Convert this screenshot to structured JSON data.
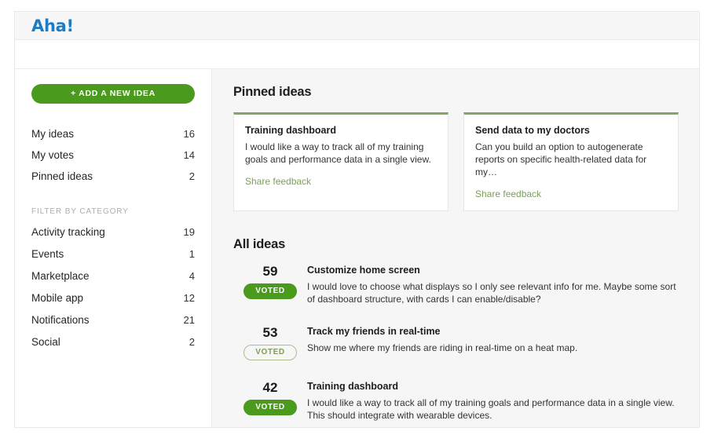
{
  "brand": {
    "logo_text": "Aha!",
    "logo_color": "#1d7cc4"
  },
  "sidebar": {
    "add_button_label": "+ ADD A NEW IDEA",
    "nav_items": [
      {
        "label": "My ideas",
        "count": "16"
      },
      {
        "label": "My votes",
        "count": "14"
      },
      {
        "label": "Pinned ideas",
        "count": "2"
      }
    ],
    "filter_heading": "FILTER BY CATEGORY",
    "categories": [
      {
        "label": "Activity tracking",
        "count": "19"
      },
      {
        "label": "Events",
        "count": "1"
      },
      {
        "label": "Marketplace",
        "count": "4"
      },
      {
        "label": "Mobile app",
        "count": "12"
      },
      {
        "label": "Notifications",
        "count": "21"
      },
      {
        "label": "Social",
        "count": "2"
      }
    ]
  },
  "main": {
    "pinned_title": "Pinned ideas",
    "pinned_cards": [
      {
        "title": "Training dashboard",
        "body": "I would like a way to track all of my training goals and performance data in a single view.",
        "link": "Share feedback"
      },
      {
        "title": "Send data to my doctors",
        "body": "Can you build an option to autogenerate reports on specific health-related data for my…",
        "link": "Share feedback"
      }
    ],
    "all_ideas_title": "All ideas",
    "ideas": [
      {
        "votes": "59",
        "badge": "VOTED",
        "badge_style": "filled",
        "title": "Customize home screen",
        "description": "I would love to choose what displays so I only see relevant info for me. Maybe some sort of dashboard structure, with cards I can enable/disable?"
      },
      {
        "votes": "53",
        "badge": "VOTED",
        "badge_style": "outline",
        "title": "Track my friends in real-time",
        "description": "Show me where my friends are riding in real-time on a heat map."
      },
      {
        "votes": "42",
        "badge": "VOTED",
        "badge_style": "filled",
        "title": "Training dashboard",
        "description": "I would like a way to track all of my training goals and performance data in a single view. This should integrate with wearable devices."
      }
    ]
  },
  "colors": {
    "green_primary": "#4a9a1e",
    "green_muted": "#7d9e5a",
    "brand_blue": "#1d7cc4"
  }
}
